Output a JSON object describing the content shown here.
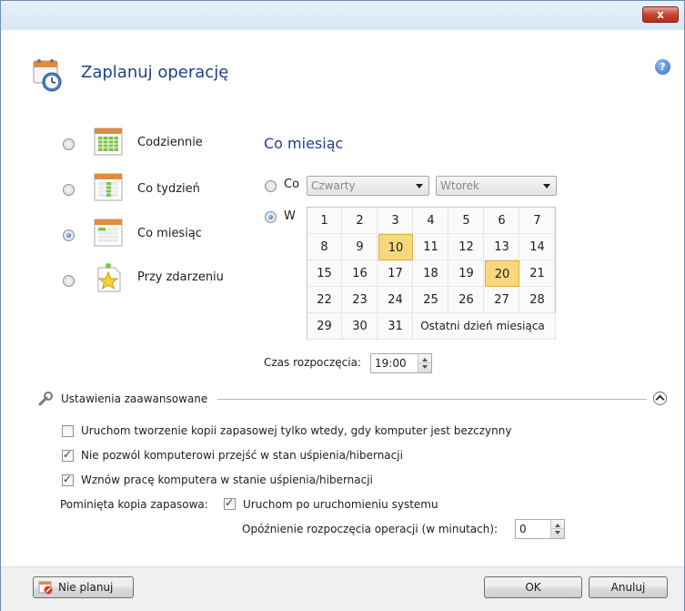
{
  "window": {
    "close_glyph": "x",
    "title": "Zaplanuj operację",
    "help_glyph": "?"
  },
  "schedule_types": [
    {
      "label": "Codziennie",
      "selected": false,
      "icon": "daily-calendar-icon"
    },
    {
      "label": "Co tydzień",
      "selected": false,
      "icon": "weekly-calendar-icon"
    },
    {
      "label": "Co miesiąc",
      "selected": true,
      "icon": "monthly-calendar-icon"
    },
    {
      "label": "Przy zdarzeniu",
      "selected": false,
      "icon": "event-star-icon"
    }
  ],
  "monthly": {
    "heading": "Co miesiąc",
    "option_co_label": "Co",
    "option_w_label": "W",
    "option_w_selected": true,
    "week_select_value": "Czwarty",
    "day_select_value": "Wtorek",
    "calendar_rows": [
      [
        "1",
        "2",
        "3",
        "4",
        "5",
        "6",
        "7"
      ],
      [
        "8",
        "9",
        "10",
        "11",
        "12",
        "13",
        "14"
      ],
      [
        "15",
        "16",
        "17",
        "18",
        "19",
        "20",
        "21"
      ],
      [
        "22",
        "23",
        "24",
        "25",
        "26",
        "27",
        "28"
      ],
      [
        "29",
        "30",
        "31"
      ]
    ],
    "last_day_label": "Ostatni dzień miesiąca",
    "selected_days": [
      "10",
      "20"
    ],
    "start_time_label": "Czas rozpoczęcia:",
    "start_time_value": "19:00"
  },
  "advanced": {
    "label": "Ustawienia zaawansowane",
    "options": [
      {
        "label": "Uruchom tworzenie kopii zapasowej tylko wtedy, gdy komputer jest bezczynny",
        "checked": false
      },
      {
        "label": "Nie pozwól komputerowi przejść w stan uśpienia/hibernacji",
        "checked": true
      },
      {
        "label": "Wznów pracę komputera w stanie uśpienia/hibernacji",
        "checked": true
      }
    ],
    "missed_backup_label": "Pominięta kopia zapasowa:",
    "run_after_start_label": "Uruchom po uruchomieniu systemu",
    "run_after_start_checked": true,
    "delay_label": "Opóźnienie rozpoczęcia operacji (w minutach):",
    "delay_value": "0"
  },
  "footer": {
    "no_schedule_label": "Nie planuj",
    "ok_label": "OK",
    "cancel_label": "Anuluj"
  },
  "colors": {
    "title": "#1f3f8f",
    "selected_day": "#f9d77e",
    "close_button": "#c7432f"
  }
}
